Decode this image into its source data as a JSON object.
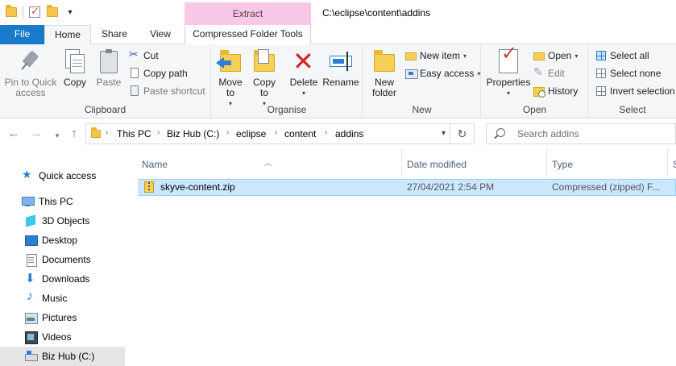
{
  "window": {
    "title_path": "C:\\eclipse\\content\\addins",
    "context_tab_header": "Extract"
  },
  "tabs": {
    "file": "File",
    "home": "Home",
    "share": "Share",
    "view": "View",
    "context": "Compressed Folder Tools"
  },
  "ribbon": {
    "clipboard": {
      "label": "Clipboard",
      "pin": "Pin to Quick access",
      "copy": "Copy",
      "paste": "Paste",
      "cut": "Cut",
      "copy_path": "Copy path",
      "paste_shortcut": "Paste shortcut"
    },
    "organise": {
      "label": "Organise",
      "move_to": "Move to",
      "copy_to": "Copy to",
      "delete": "Delete",
      "rename": "Rename"
    },
    "new": {
      "label": "New",
      "new_folder": "New folder",
      "new_item": "New item",
      "easy_access": "Easy access"
    },
    "open": {
      "label": "Open",
      "properties": "Properties",
      "open": "Open",
      "edit": "Edit",
      "history": "History"
    },
    "select": {
      "label": "Select",
      "select_all": "Select all",
      "select_none": "Select none",
      "invert_selection": "Invert selection"
    }
  },
  "address": {
    "crumbs": [
      "This PC",
      "Biz Hub (C:)",
      "eclipse",
      "content",
      "addins"
    ],
    "search_placeholder": "Search addins"
  },
  "nav_pane": {
    "items": [
      {
        "label": "Quick access",
        "icon": "star-icon"
      },
      {
        "label": "This PC",
        "icon": "computer-icon"
      },
      {
        "label": "3D Objects",
        "icon": "3d-objects-icon"
      },
      {
        "label": "Desktop",
        "icon": "desktop-icon"
      },
      {
        "label": "Documents",
        "icon": "documents-icon"
      },
      {
        "label": "Downloads",
        "icon": "downloads-icon"
      },
      {
        "label": "Music",
        "icon": "music-icon"
      },
      {
        "label": "Pictures",
        "icon": "pictures-icon"
      },
      {
        "label": "Videos",
        "icon": "videos-icon"
      },
      {
        "label": "Biz Hub (C:)",
        "icon": "drive-icon"
      }
    ]
  },
  "file_list": {
    "columns": [
      "Name",
      "Date modified",
      "Type",
      "S"
    ],
    "rows": [
      {
        "name": "skyve-content.zip",
        "date_modified": "27/04/2021 2:54 PM",
        "type": "Compressed (zipped) F..."
      }
    ]
  },
  "colors": {
    "file_tab": "#1979ca",
    "context_tab": "#f8c8e6",
    "selection": "#cce8ff"
  }
}
